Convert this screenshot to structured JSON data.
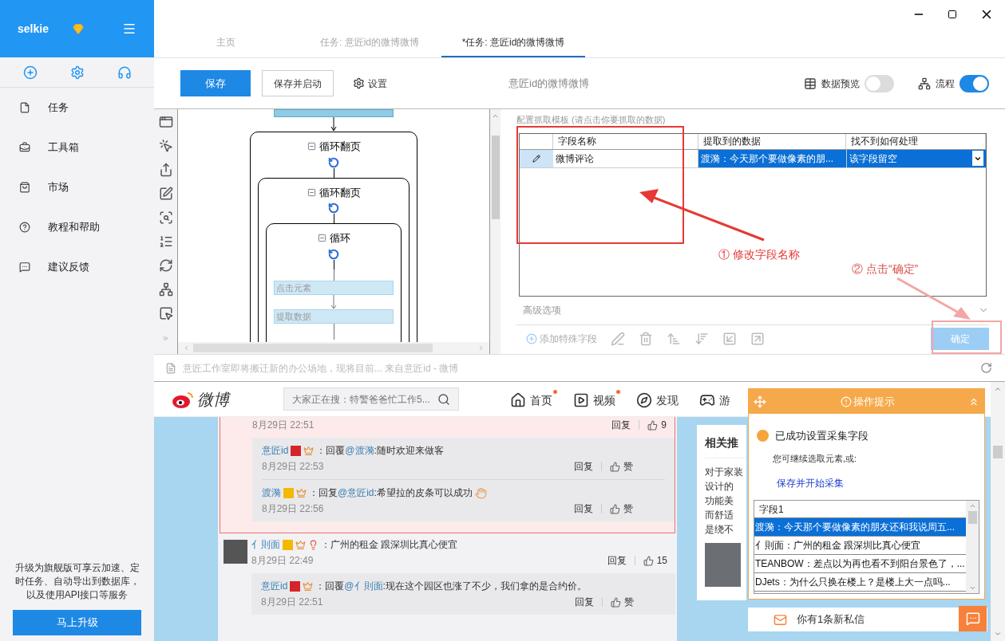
{
  "sidebar": {
    "brand": "selkie",
    "items": [
      {
        "label": "任务"
      },
      {
        "label": "工具箱"
      },
      {
        "label": "市场"
      },
      {
        "label": "教程和帮助"
      },
      {
        "label": "建议反馈"
      }
    ],
    "promo": "升级为旗舰版可享云加速、定时任务、自动导出到数据库，以及使用API接口等服务",
    "upgrade_button": "马上升级"
  },
  "tabs": [
    {
      "label": "主页",
      "selected": false
    },
    {
      "label": "任务: 意匠id的微博微博",
      "selected": false
    },
    {
      "label": "*任务: 意匠id的微博微博",
      "selected": true
    }
  ],
  "toolbar": {
    "save": "保存",
    "save_and_start": "保存并启动",
    "settings": "设置",
    "title": "意匠id的微博微博",
    "toggles": [
      {
        "label": "数据预览",
        "on": false
      },
      {
        "label": "流程",
        "on": true
      }
    ]
  },
  "flow": {
    "loops": [
      {
        "label": "循环翻页"
      },
      {
        "label": "循环翻页"
      },
      {
        "label": "循环"
      }
    ],
    "steps": [
      {
        "label": "点击元素"
      },
      {
        "label": "提取数据"
      }
    ]
  },
  "fields_panel": {
    "caption": "配置抓取模板 (请点击你要抓取的数据)",
    "columns": [
      "字段名称",
      "提取到的数据",
      "找不到如何处理"
    ],
    "rows": [
      {
        "name": "微博评论",
        "data": "渡漪：今天那个要做像素的朋...",
        "fallback": "该字段留空",
        "selected": true
      }
    ],
    "advanced": "高级选项",
    "add_field": "添加特殊字段",
    "confirm": "确定"
  },
  "annotations": [
    "① 修改字段名称",
    "② 点击“确定”"
  ],
  "browser": {
    "address": "意匠工作室即将搬迁新的办公场地，现将目前... 来自意匠id - 微博",
    "weibo": {
      "logo": "微博",
      "search_placeholder": "大家正在搜：特警爸爸忙工作5...",
      "nav": [
        {
          "label": "首页",
          "dot": true
        },
        {
          "label": "视频",
          "dot": true
        },
        {
          "label": "发现",
          "dot": false
        },
        {
          "label": "游",
          "dot": false
        }
      ],
      "comments": [
        {
          "highlighted": true,
          "time": "8月29日 22:51",
          "reply_label": "回复",
          "likes": "9",
          "replies": [
            {
              "author": "意匠id",
              "color": "#d4252b",
              "prefix": "：回覆",
              "mention": "@渡漪",
              "text": ":随时欢迎来做客",
              "time": "8月29日 22:53",
              "reply_label": "回复",
              "like_label": "赞"
            },
            {
              "author": "渡漪",
              "color": "#f5b800",
              "prefix": "：回复",
              "mention": "@意匠id",
              "text": ":希望拉的皮条可以成功",
              "time": "8月29日 22:56",
              "reply_label": "回复",
              "like_label": "赞"
            }
          ]
        },
        {
          "highlighted": false,
          "author": "亻則面",
          "color": "#f5b800",
          "text": "：广州的租金 跟深圳比真心便宜",
          "time": "8月29日 22:49",
          "reply_label": "回复",
          "likes": "15",
          "replies": [
            {
              "author": "意匠id",
              "color": "#d4252b",
              "prefix": "：回覆",
              "mention": "@亻則面",
              "text": ":现在这个园区也涨了不少，我们拿的是合约价。",
              "time": "8月29日 22:51",
              "reply_label": "回复",
              "like_label": "赞"
            }
          ]
        }
      ],
      "related": {
        "title": "相关推",
        "lines": [
          "对于家装",
          "设计的",
          "功能美",
          "而舒适",
          "是绕不"
        ]
      },
      "popup": {
        "title": "操作提示",
        "message": "已成功设置采集字段",
        "hint": "您可继续选取元素,或:",
        "link": "保存并开始采集",
        "list_header": "字段1",
        "items": [
          {
            "text": "渡漪：今天那个要做像素的朋友还和我说周五...",
            "selected": true
          },
          {
            "text": "亻則面：广州的租金 跟深圳比真心便宜",
            "selected": false
          },
          {
            "text": "TEANBOW：差点以为再也看不到阳台景色了，...",
            "selected": false
          },
          {
            "text": "DJets：为什么只换在楼上？是楼上大一点吗...",
            "selected": false
          }
        ]
      },
      "message_bar": "你有1条新私信"
    }
  }
}
